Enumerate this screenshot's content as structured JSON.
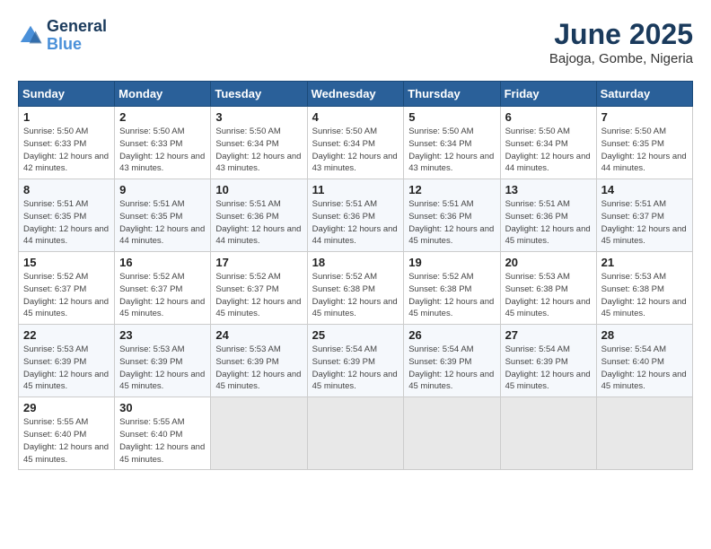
{
  "logo": {
    "line1": "General",
    "line2": "Blue"
  },
  "title": "June 2025",
  "location": "Bajoga, Gombe, Nigeria",
  "days_of_week": [
    "Sunday",
    "Monday",
    "Tuesday",
    "Wednesday",
    "Thursday",
    "Friday",
    "Saturday"
  ],
  "weeks": [
    [
      {
        "day": "1",
        "sunrise": "5:50 AM",
        "sunset": "6:33 PM",
        "daylight": "12 hours and 42 minutes."
      },
      {
        "day": "2",
        "sunrise": "5:50 AM",
        "sunset": "6:33 PM",
        "daylight": "12 hours and 43 minutes."
      },
      {
        "day": "3",
        "sunrise": "5:50 AM",
        "sunset": "6:34 PM",
        "daylight": "12 hours and 43 minutes."
      },
      {
        "day": "4",
        "sunrise": "5:50 AM",
        "sunset": "6:34 PM",
        "daylight": "12 hours and 43 minutes."
      },
      {
        "day": "5",
        "sunrise": "5:50 AM",
        "sunset": "6:34 PM",
        "daylight": "12 hours and 43 minutes."
      },
      {
        "day": "6",
        "sunrise": "5:50 AM",
        "sunset": "6:34 PM",
        "daylight": "12 hours and 44 minutes."
      },
      {
        "day": "7",
        "sunrise": "5:50 AM",
        "sunset": "6:35 PM",
        "daylight": "12 hours and 44 minutes."
      }
    ],
    [
      {
        "day": "8",
        "sunrise": "5:51 AM",
        "sunset": "6:35 PM",
        "daylight": "12 hours and 44 minutes."
      },
      {
        "day": "9",
        "sunrise": "5:51 AM",
        "sunset": "6:35 PM",
        "daylight": "12 hours and 44 minutes."
      },
      {
        "day": "10",
        "sunrise": "5:51 AM",
        "sunset": "6:36 PM",
        "daylight": "12 hours and 44 minutes."
      },
      {
        "day": "11",
        "sunrise": "5:51 AM",
        "sunset": "6:36 PM",
        "daylight": "12 hours and 44 minutes."
      },
      {
        "day": "12",
        "sunrise": "5:51 AM",
        "sunset": "6:36 PM",
        "daylight": "12 hours and 45 minutes."
      },
      {
        "day": "13",
        "sunrise": "5:51 AM",
        "sunset": "6:36 PM",
        "daylight": "12 hours and 45 minutes."
      },
      {
        "day": "14",
        "sunrise": "5:51 AM",
        "sunset": "6:37 PM",
        "daylight": "12 hours and 45 minutes."
      }
    ],
    [
      {
        "day": "15",
        "sunrise": "5:52 AM",
        "sunset": "6:37 PM",
        "daylight": "12 hours and 45 minutes."
      },
      {
        "day": "16",
        "sunrise": "5:52 AM",
        "sunset": "6:37 PM",
        "daylight": "12 hours and 45 minutes."
      },
      {
        "day": "17",
        "sunrise": "5:52 AM",
        "sunset": "6:37 PM",
        "daylight": "12 hours and 45 minutes."
      },
      {
        "day": "18",
        "sunrise": "5:52 AM",
        "sunset": "6:38 PM",
        "daylight": "12 hours and 45 minutes."
      },
      {
        "day": "19",
        "sunrise": "5:52 AM",
        "sunset": "6:38 PM",
        "daylight": "12 hours and 45 minutes."
      },
      {
        "day": "20",
        "sunrise": "5:53 AM",
        "sunset": "6:38 PM",
        "daylight": "12 hours and 45 minutes."
      },
      {
        "day": "21",
        "sunrise": "5:53 AM",
        "sunset": "6:38 PM",
        "daylight": "12 hours and 45 minutes."
      }
    ],
    [
      {
        "day": "22",
        "sunrise": "5:53 AM",
        "sunset": "6:39 PM",
        "daylight": "12 hours and 45 minutes."
      },
      {
        "day": "23",
        "sunrise": "5:53 AM",
        "sunset": "6:39 PM",
        "daylight": "12 hours and 45 minutes."
      },
      {
        "day": "24",
        "sunrise": "5:53 AM",
        "sunset": "6:39 PM",
        "daylight": "12 hours and 45 minutes."
      },
      {
        "day": "25",
        "sunrise": "5:54 AM",
        "sunset": "6:39 PM",
        "daylight": "12 hours and 45 minutes."
      },
      {
        "day": "26",
        "sunrise": "5:54 AM",
        "sunset": "6:39 PM",
        "daylight": "12 hours and 45 minutes."
      },
      {
        "day": "27",
        "sunrise": "5:54 AM",
        "sunset": "6:39 PM",
        "daylight": "12 hours and 45 minutes."
      },
      {
        "day": "28",
        "sunrise": "5:54 AM",
        "sunset": "6:40 PM",
        "daylight": "12 hours and 45 minutes."
      }
    ],
    [
      {
        "day": "29",
        "sunrise": "5:55 AM",
        "sunset": "6:40 PM",
        "daylight": "12 hours and 45 minutes."
      },
      {
        "day": "30",
        "sunrise": "5:55 AM",
        "sunset": "6:40 PM",
        "daylight": "12 hours and 45 minutes."
      },
      null,
      null,
      null,
      null,
      null
    ]
  ],
  "labels": {
    "sunrise": "Sunrise:",
    "sunset": "Sunset:",
    "daylight": "Daylight:"
  }
}
